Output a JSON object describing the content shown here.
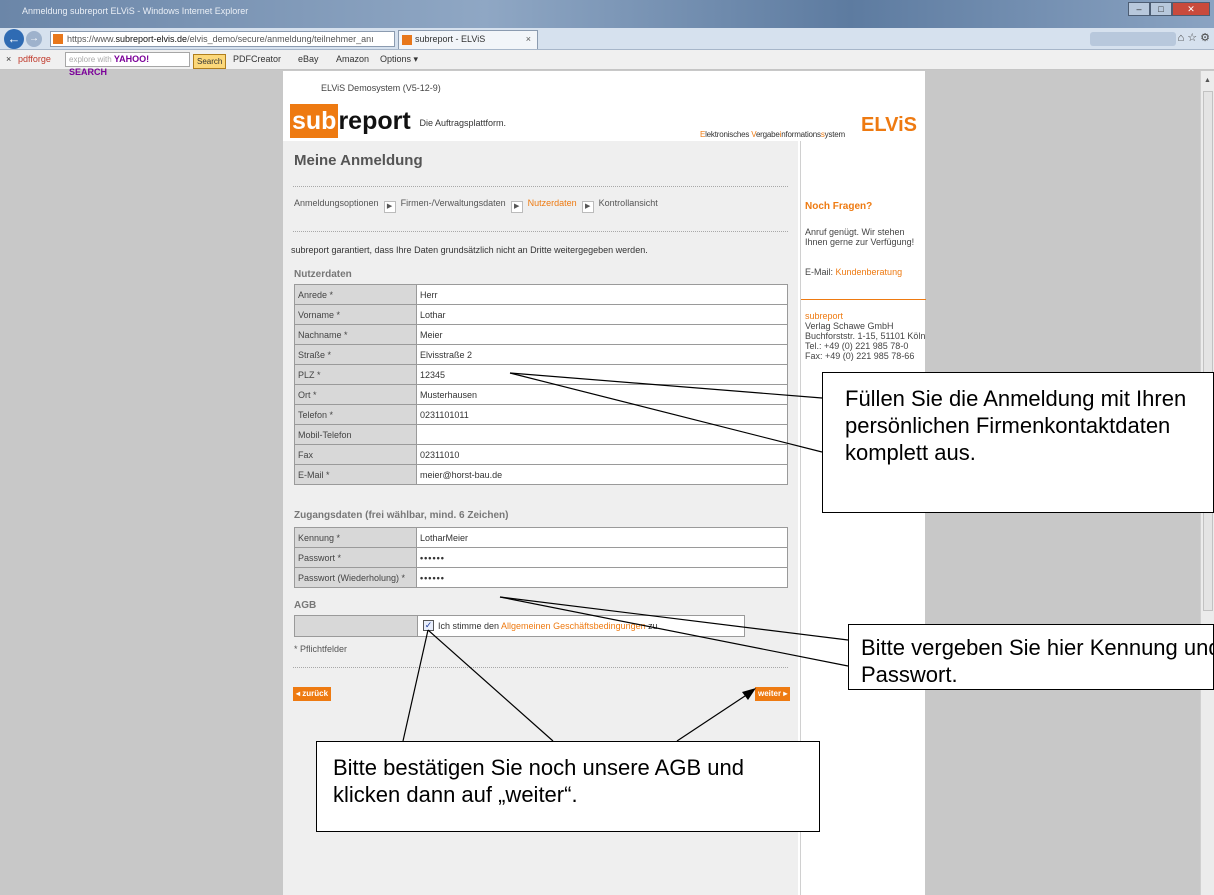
{
  "browser": {
    "title_text": "Anmeldung subreport ELViS - Windows Internet Explorer",
    "url_prefix": "https://www.",
    "url_domain": "subreport-elvis.de",
    "url_rest": "/elvis_demo/secure/anmeldung/teilnehmer_anı",
    "addr_controls": "ρ ▾ 🔒 ⟳ ⟲ ✕",
    "tab_label": "subreport - ELViS",
    "tab_close": "×",
    "right_icons": "⌂ ☆ ⚙"
  },
  "toolbar": {
    "close": "×",
    "pdfforge": "pdfforge",
    "search_placeholder": "explore with",
    "yahoo": "YAHOO! SEARCH",
    "search_button": "Search",
    "pdfcreator": "PDFCreator",
    "ebay": "eBay",
    "amazon": "Amazon",
    "options": "Options ▾"
  },
  "page": {
    "demo_label": "ELViS Demosystem (V5-12-9)",
    "logo_sub": "sub",
    "logo_report": "report",
    "logo_tagline": "Die Auftragsplattform.",
    "elvis_e": "E",
    "elvis_lektronisches": "lektronisches ",
    "elvis_v": "V",
    "elvis_ergabe": "ergabe",
    "elvis_i": "i",
    "elvis_nformations": "nformations",
    "elvis_s": "s",
    "elvis_ystem": "ystem",
    "elvis_logo": "ELViS",
    "heading": "Meine Anmeldung",
    "steps": [
      {
        "label": "Anmeldungsoptionen"
      },
      {
        "label": "Firmen-/Verwaltungsdaten"
      },
      {
        "label": "Nutzerdaten"
      },
      {
        "label": "Kontrollansicht"
      }
    ],
    "step_arrow": "▶",
    "intro": "subreport garantiert, dass Ihre Daten grundsätzlich nicht an Dritte weitergegeben werden.",
    "section_user": "Nutzerdaten",
    "user_fields": [
      {
        "label": "Anrede *",
        "value": "Herr"
      },
      {
        "label": "Vorname *",
        "value": "Lothar"
      },
      {
        "label": "Nachname *",
        "value": "Meier"
      },
      {
        "label": "Straße *",
        "value": "Elvisstraße 2"
      },
      {
        "label": "PLZ *",
        "value": "12345"
      },
      {
        "label": "Ort *",
        "value": "Musterhausen"
      },
      {
        "label": "Telefon *",
        "value": "0231101011"
      },
      {
        "label": "Mobil-Telefon",
        "value": ""
      },
      {
        "label": "Fax",
        "value": "02311010"
      },
      {
        "label": "E-Mail *",
        "value": "meier@horst-bau.de"
      }
    ],
    "section_access": "Zugangsdaten (frei wählbar, mind. 6 Zeichen)",
    "access_fields": [
      {
        "label": "Kennung *",
        "value": "LotharMeier"
      },
      {
        "label": "Passwort *",
        "value": "••••••"
      },
      {
        "label": "Passwort (Wiederholung) *",
        "value": "••••••"
      }
    ],
    "section_agb": "AGB",
    "agb_check": "✓",
    "agb_prefix": "Ich stimme den ",
    "agb_link": "Allgemeinen Geschäftsbedingungen",
    "agb_suffix": " zu.",
    "required_note": "* Pflichtfelder",
    "back_button": "◂ zurück",
    "next_button": "weiter ▸"
  },
  "sidebar": {
    "heading": "Noch Fragen?",
    "text": "Anruf genügt. Wir stehen Ihnen gerne zur Verfügung!",
    "mail_label": "E-Mail: ",
    "mail_link": "Kundenberatung",
    "addr_company": "subreport",
    "addr_lines": [
      "Verlag Schawe GmbH",
      "Buchforststr. 1-15, 51101 Köln",
      "Tel.: +49 (0) 221 985 78-0",
      "Fax: +49 (0) 221 985 78-66"
    ]
  },
  "callouts": {
    "fill": "Füllen Sie die Anmeldung mit Ihren persönlichen Firmenkontaktdaten komplett aus.",
    "password": "Bitte vergeben Sie hier Kennung und Passwort.",
    "agb": "Bitte bestätigen Sie noch unsere AGB und klicken dann auf „weiter“."
  }
}
